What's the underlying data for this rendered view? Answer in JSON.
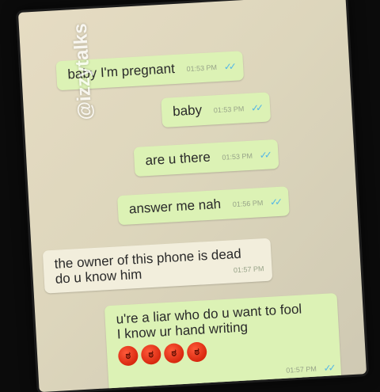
{
  "watermark": "@izzytalks",
  "messages": [
    {
      "text": "baby I'm pregnant",
      "time": "01:53 PM",
      "ticks": "✓✓"
    },
    {
      "text": "baby",
      "time": "01:53 PM",
      "ticks": "✓✓"
    },
    {
      "text": "are u there",
      "time": "01:53 PM",
      "ticks": "✓✓"
    },
    {
      "text": "answer me nah",
      "time": "01:56 PM",
      "ticks": "✓✓"
    },
    {
      "line1": "the owner of this phone is dead",
      "line2": "do u know him",
      "time": "01:57 PM"
    },
    {
      "line1": "u're a liar who do u want to fool",
      "line2": "I know ur hand writing",
      "time": "01:57 PM",
      "ticks": "✓✓",
      "emojis": [
        "angry-face",
        "angry-face",
        "angry-face",
        "angry-face"
      ]
    }
  ],
  "colors": {
    "outgoing_bubble": "#dcf2b5",
    "incoming_bubble": "#f2eedc",
    "read_ticks": "#55b7e6",
    "background": "#0b0b0b"
  }
}
